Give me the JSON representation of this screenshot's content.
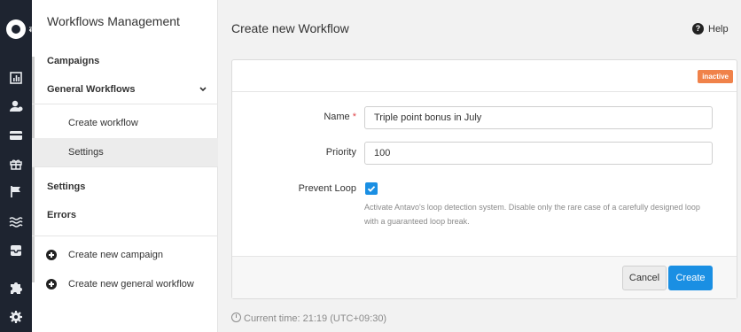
{
  "rail": {
    "icons": [
      "logo-icon",
      "swap-icon",
      "report-icon",
      "user-icon",
      "card-icon",
      "gift-icon",
      "flag-icon",
      "waves-icon",
      "inbox-icon",
      "puzzle-icon",
      "gear-icon"
    ],
    "swap_glyph": "⇄"
  },
  "sidebar": {
    "title": "Workflows Management",
    "items": [
      {
        "label": "Campaigns"
      },
      {
        "label": "General Workflows"
      },
      {
        "label": "Create workflow"
      },
      {
        "label": "Settings"
      },
      {
        "label": "Settings"
      },
      {
        "label": "Errors"
      }
    ],
    "actions": [
      {
        "label": "Create new campaign"
      },
      {
        "label": "Create new general workflow"
      }
    ]
  },
  "header": {
    "title": "Create new Workflow",
    "help_label": "Help",
    "help_glyph": "?"
  },
  "form": {
    "status_badge": "inactive",
    "name_label": "Name",
    "required_mark": "*",
    "name_value": "Triple point bonus in July",
    "priority_label": "Priority",
    "priority_value": "100",
    "prevent_loop_label": "Prevent Loop",
    "prevent_loop_checked": true,
    "prevent_loop_help": "Activate Antavo's loop detection system. Disable only the rare case of a carefully designed loop with a guaranteed loop break.",
    "cancel_label": "Cancel",
    "create_label": "Create"
  },
  "footer": {
    "current_time": "Current time: 21:19 (UTC+09:30)"
  },
  "colors": {
    "accent": "#1a8fe3",
    "badge": "#f0824a",
    "rail": "#1e2430"
  }
}
